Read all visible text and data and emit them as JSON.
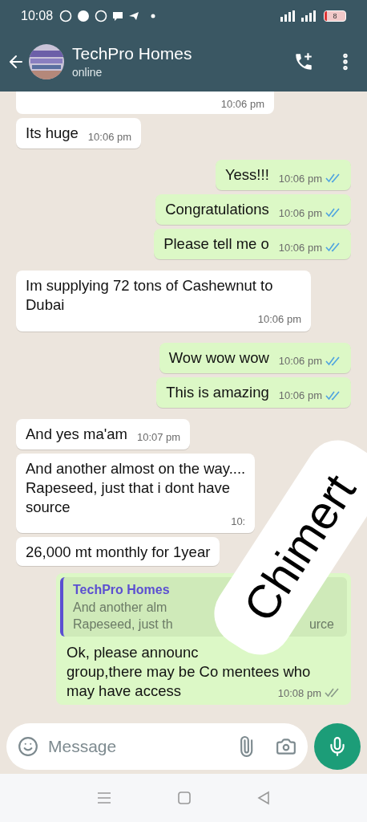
{
  "status_bar": {
    "time": "10:08",
    "battery": "8"
  },
  "header": {
    "name": "TechPro Homes",
    "status": "online"
  },
  "messages": [
    {
      "kind": "partial",
      "time": "10:06 pm"
    },
    {
      "kind": "incoming",
      "text": "Its huge",
      "time": "10:06 pm"
    },
    {
      "kind": "outgoing",
      "text": "Yess!!!",
      "time": "10:06 pm",
      "read": true
    },
    {
      "kind": "outgoing",
      "text": "Congratulations",
      "time": "10:06 pm",
      "read": true
    },
    {
      "kind": "outgoing",
      "text": "Please tell me o",
      "time": "10:06 pm",
      "read": true
    },
    {
      "kind": "incoming",
      "text": "Im supplying 72 tons of Cashewnut to Dubai",
      "time": "10:06 pm"
    },
    {
      "kind": "outgoing",
      "text": "Wow wow wow",
      "time": "10:06 pm",
      "read": true
    },
    {
      "kind": "outgoing",
      "text": "This is amazing",
      "time": "10:06 pm",
      "read": true
    },
    {
      "kind": "incoming",
      "text": "And yes ma'am",
      "time": "10:07 pm"
    },
    {
      "kind": "incoming",
      "text": "And another almost on the way....\nRapeseed, just that i dont have\nsource",
      "time": "10:"
    },
    {
      "kind": "incoming",
      "text": "26,000 mt monthly for 1year"
    },
    {
      "kind": "reply",
      "quote_name": "TechPro Homes",
      "quote_lines": [
        [
          "And another alm"
        ],
        [
          "Rapeseed, just th",
          "urce"
        ]
      ],
      "text_lines": [
        "Ok, please announc",
        "group,there may be Co mentees who",
        "may have access"
      ],
      "time": "10:08 pm",
      "read": false
    }
  ],
  "sticker": {
    "text": "Chimert"
  },
  "composer": {
    "placeholder": "Message"
  }
}
